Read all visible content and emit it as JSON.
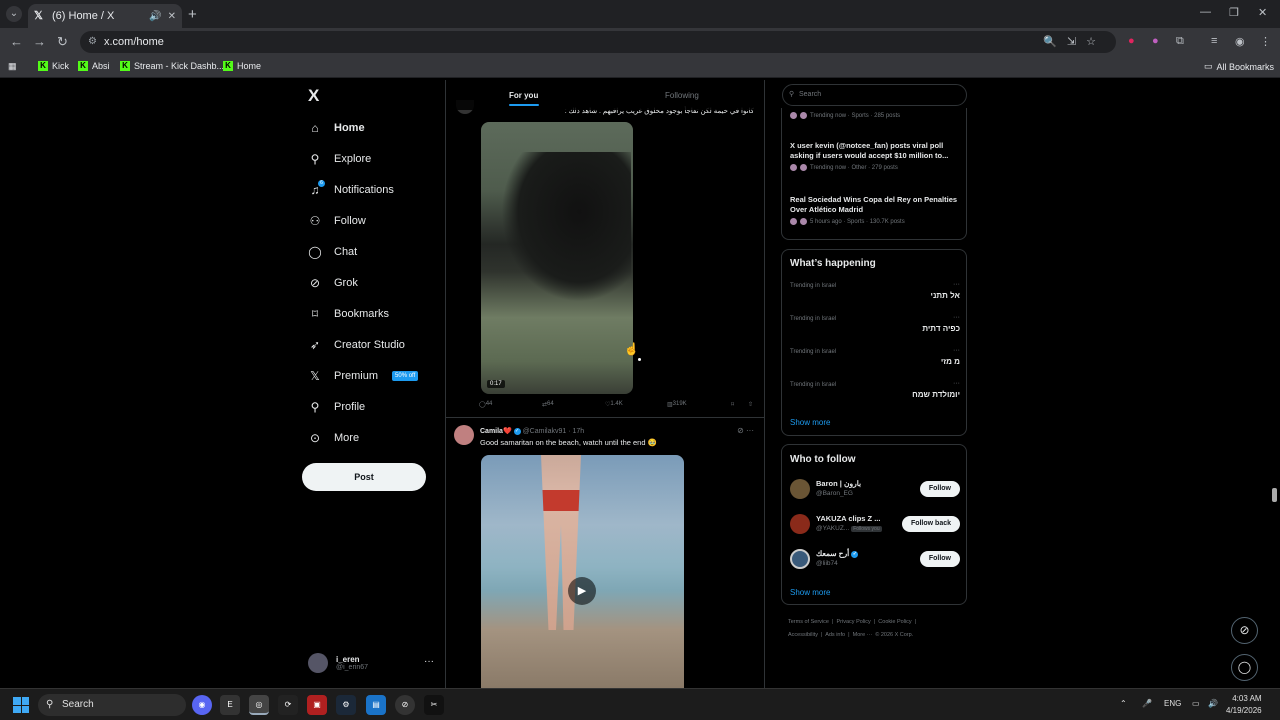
{
  "browser": {
    "tab_title": "(6) Home / X",
    "url": "x.com/home",
    "bookmarks": [
      "Kick",
      "Absi",
      "Stream - Kick Dashb...",
      "Home"
    ],
    "all_bookmarks": "All Bookmarks"
  },
  "sidebar": {
    "logo": "X",
    "items": [
      {
        "label": "Home",
        "icon": "home-icon"
      },
      {
        "label": "Explore",
        "icon": "search-icon"
      },
      {
        "label": "Notifications",
        "icon": "bell-icon"
      },
      {
        "label": "Follow",
        "icon": "person-add-icon"
      },
      {
        "label": "Chat",
        "icon": "chat-icon"
      },
      {
        "label": "Grok",
        "icon": "grok-icon"
      },
      {
        "label": "Bookmarks",
        "icon": "bookmark-icon"
      },
      {
        "label": "Creator Studio",
        "icon": "rocket-icon"
      },
      {
        "label": "Premium",
        "icon": "x-icon"
      },
      {
        "label": "Profile",
        "icon": "person-icon"
      },
      {
        "label": "More",
        "icon": "more-circle-icon"
      }
    ],
    "premium_badge": "50% off",
    "post_button": "Post",
    "user": {
      "name": "i_eren",
      "handle": "@i_erin67"
    }
  },
  "feed": {
    "tabs": [
      "For you",
      "Following"
    ],
    "post1": {
      "text": "كانوا في خيمة لكن تفاجأ بوجود مخلوق غريب يراقبهم . شاهد ذلك :",
      "duration": "0:17",
      "replies": "44",
      "reposts": "64",
      "likes": "1.4K",
      "views": "319K"
    },
    "post2": {
      "author": "Camila❤️",
      "handle": "@Camilakv91",
      "time": "· 17h",
      "text": "Good samaritan on the beach, watch until the end 🥹"
    }
  },
  "right": {
    "search_placeholder": "Search",
    "news": [
      {
        "meta": "Trending now · Sports · 285 posts"
      },
      {
        "title": "X user kevin (@notcee_fan) posts viral poll asking if users would accept $10 million to...",
        "meta": "Trending now · Other · 279 posts"
      },
      {
        "title": "Real Sociedad Wins Copa del Rey on Penalties Over Atlético Madrid",
        "meta": "5 hours ago · Sports · 130.7K posts"
      }
    ],
    "whats_happening": {
      "heading": "What’s happening",
      "trends": [
        {
          "loc": "Trending in Israel",
          "name": "אל תתני"
        },
        {
          "loc": "Trending in Israel",
          "name": "כפיה דתית"
        },
        {
          "loc": "Trending in Israel",
          "name": "מ מזי"
        },
        {
          "loc": "Trending in Israel",
          "name": "יומולדת שמח"
        }
      ],
      "show_more": "Show more"
    },
    "who_to_follow": {
      "heading": "Who to follow",
      "users": [
        {
          "name": "Baron | بارون",
          "handle": "@Baron_EG",
          "button": "Follow"
        },
        {
          "name": "YAKUZA clips Z ...",
          "handle": "@YAKUZ...",
          "follows_you": "Follows you",
          "button": "Follow back"
        },
        {
          "name": "أرح سمعك",
          "handle": "@liib74",
          "button": "Follow"
        }
      ],
      "show_more": "Show more"
    },
    "footer": {
      "line1": [
        "Terms of Service",
        "Privacy Policy",
        "Cookie Policy"
      ],
      "line2": [
        "Accessibility",
        "Ads info",
        "More ···",
        "© 2026 X Corp."
      ]
    }
  },
  "taskbar": {
    "search": "Search",
    "lang": "ENG",
    "time": "4:03 AM",
    "date": "4/19/2026"
  }
}
